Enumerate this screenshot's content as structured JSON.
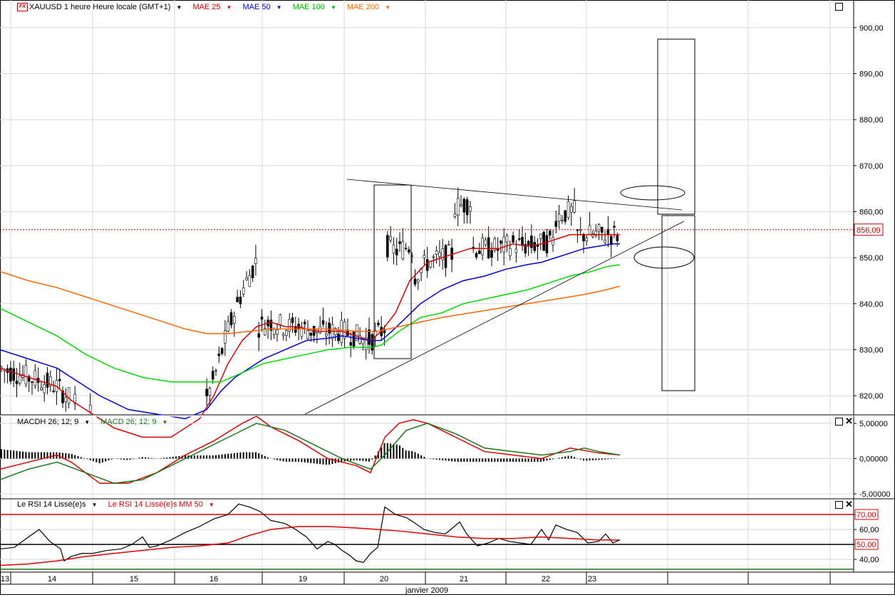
{
  "header": {
    "symbol": "XAUUSD 1 heure Heure locale (GMT+1)",
    "mae25": "MAE 25",
    "mae50": "MAE 50",
    "mae100": "MAE 100",
    "mae200": "MAE 200"
  },
  "macd_header": {
    "hist": "MACDH 26; 12; 9",
    "line": "MACD  26; 12; 9"
  },
  "rsi_header": {
    "rsi": "Le RSI 14 Lissé(e)s",
    "rsi_ma": "Le RSI 14 Lissé(e)s MM 50"
  },
  "colors": {
    "mae25": "#e00000",
    "mae50": "#0000e0",
    "mae100": "#00dd00",
    "mae200": "#ff6600",
    "macd_signal": "#1a7a1a",
    "grid": "#d8d8d8",
    "last_price": "#cc0000"
  },
  "x_axis": {
    "days": [
      "13",
      "14",
      "15",
      "16",
      "19",
      "20",
      "21",
      "22",
      "23"
    ],
    "month": "janvier 2009"
  },
  "chart_data": [
    {
      "type": "line",
      "title": "XAUUSD 1 heure",
      "price_axis": {
        "ticks": [
          "900,00",
          "890,00",
          "880,00",
          "870,00",
          "860,00",
          "850,00",
          "840,00",
          "830,00",
          "820,00"
        ],
        "ylim": [
          816,
          906
        ]
      },
      "last_price": "856,09",
      "series": [
        {
          "name": "MAE 25",
          "color": "#e00000",
          "points": [
            [
              0,
              826
            ],
            [
              40,
              824
            ],
            [
              80,
              822
            ],
            [
              100,
              819
            ],
            [
              130,
              816
            ],
            [
              160,
              813
            ],
            [
              200,
              811
            ],
            [
              240,
              811
            ],
            [
              280,
              815
            ],
            [
              300,
              820
            ],
            [
              320,
              827
            ],
            [
              340,
              832
            ],
            [
              360,
              835
            ],
            [
              380,
              836
            ],
            [
              400,
              835
            ],
            [
              420,
              835
            ],
            [
              440,
              834
            ],
            [
              460,
              834
            ],
            [
              480,
              834
            ],
            [
              500,
              833
            ],
            [
              520,
              832
            ],
            [
              535,
              834
            ],
            [
              555,
              838
            ],
            [
              575,
              845
            ],
            [
              600,
              849
            ],
            [
              620,
              850
            ],
            [
              640,
              851
            ],
            [
              660,
              852
            ],
            [
              680,
              852
            ],
            [
              700,
              852
            ],
            [
              720,
              853
            ],
            [
              740,
              852.5
            ],
            [
              760,
              853
            ],
            [
              780,
              854
            ],
            [
              800,
              855
            ],
            [
              820,
              855
            ],
            [
              840,
              855
            ],
            [
              860,
              855
            ],
            [
              870,
              855
            ]
          ]
        },
        {
          "name": "MAE 50",
          "color": "#0000e0",
          "points": [
            [
              0,
              830
            ],
            [
              40,
              828
            ],
            [
              80,
              826
            ],
            [
              110,
              823
            ],
            [
              140,
              820
            ],
            [
              180,
              817
            ],
            [
              220,
              816
            ],
            [
              260,
              815
            ],
            [
              290,
              817
            ],
            [
              310,
              821
            ],
            [
              330,
              824
            ],
            [
              350,
              826
            ],
            [
              370,
              828
            ],
            [
              400,
              830
            ],
            [
              430,
              832
            ],
            [
              460,
              832.5
            ],
            [
              480,
              833
            ],
            [
              500,
              832.5
            ],
            [
              520,
              832
            ],
            [
              535,
              832
            ],
            [
              550,
              834
            ],
            [
              570,
              837
            ],
            [
              590,
              840
            ],
            [
              620,
              843
            ],
            [
              650,
              845
            ],
            [
              680,
              846
            ],
            [
              710,
              847.5
            ],
            [
              740,
              848.5
            ],
            [
              760,
              849
            ],
            [
              780,
              850
            ],
            [
              800,
              851
            ],
            [
              820,
              852
            ],
            [
              840,
              852.5
            ],
            [
              860,
              853
            ],
            [
              870,
              853
            ]
          ]
        },
        {
          "name": "MAE 100",
          "color": "#00dd00",
          "points": [
            [
              0,
              839
            ],
            [
              40,
              836
            ],
            [
              80,
              833
            ],
            [
              120,
              829
            ],
            [
              160,
              826
            ],
            [
              200,
              824
            ],
            [
              240,
              823
            ],
            [
              280,
              823
            ],
            [
              310,
              823
            ],
            [
              340,
              825
            ],
            [
              370,
              827
            ],
            [
              400,
              828
            ],
            [
              430,
              829
            ],
            [
              460,
              830
            ],
            [
              490,
              830.5
            ],
            [
              520,
              830.5
            ],
            [
              535,
              831
            ],
            [
              560,
              834
            ],
            [
              590,
              837
            ],
            [
              620,
              838
            ],
            [
              650,
              840
            ],
            [
              680,
              841
            ],
            [
              710,
              842
            ],
            [
              740,
              843
            ],
            [
              770,
              844.5
            ],
            [
              800,
              846
            ],
            [
              830,
              847
            ],
            [
              850,
              848
            ],
            [
              870,
              848.5
            ]
          ]
        },
        {
          "name": "MAE 200",
          "color": "#ff6600",
          "points": [
            [
              0,
              847
            ],
            [
              40,
              845
            ],
            [
              80,
              843.5
            ],
            [
              120,
              841.5
            ],
            [
              160,
              839.5
            ],
            [
              200,
              837.5
            ],
            [
              230,
              836
            ],
            [
              260,
              834.5
            ],
            [
              290,
              833.5
            ],
            [
              320,
              833.5
            ],
            [
              350,
              834
            ],
            [
              380,
              834.5
            ],
            [
              420,
              834.5
            ],
            [
              460,
              834.5
            ],
            [
              500,
              834
            ],
            [
              530,
              834
            ],
            [
              560,
              835
            ],
            [
              590,
              836
            ],
            [
              620,
              837
            ],
            [
              660,
              838
            ],
            [
              700,
              839
            ],
            [
              740,
              840
            ],
            [
              780,
              841
            ],
            [
              820,
              842
            ],
            [
              850,
              843
            ],
            [
              870,
              843.8
            ]
          ]
        }
      ]
    },
    {
      "type": "line",
      "title": "MACD 26; 12; 9",
      "y_axis": {
        "ticks": [
          "5,00000",
          "0,00000",
          "-5,00000"
        ],
        "ylim": [
          -5.6,
          6
        ]
      },
      "series": [
        {
          "name": "MACDH 26; 12; 9",
          "color": "#000000",
          "type": "bar"
        },
        {
          "name": "MACD  26; 12; 9",
          "color": "#1a7a1a"
        }
      ]
    },
    {
      "type": "line",
      "title": "Le RSI 14 Lissé(e)s",
      "y_axis": {
        "ticks": [
          "70,00",
          "60,00",
          "50,00",
          "40,00"
        ],
        "ylim": [
          32,
          80
        ],
        "levels": [
          70,
          50,
          30
        ]
      },
      "series": [
        {
          "name": "Le RSI 14 Lissé(e)s",
          "color": "#000000",
          "points": [
            [
              0,
              47
            ],
            [
              20,
              48
            ],
            [
              40,
              55
            ],
            [
              55,
              60
            ],
            [
              70,
              52
            ],
            [
              85,
              47
            ],
            [
              90,
              39
            ],
            [
              100,
              42
            ],
            [
              115,
              44
            ],
            [
              130,
              44
            ],
            [
              150,
              46
            ],
            [
              170,
              47
            ],
            [
              185,
              50
            ],
            [
              200,
              55
            ],
            [
              210,
              48
            ],
            [
              220,
              49
            ],
            [
              240,
              53
            ],
            [
              260,
              58
            ],
            [
              280,
              62
            ],
            [
              300,
              67
            ],
            [
              320,
              70
            ],
            [
              335,
              77
            ],
            [
              350,
              75
            ],
            [
              365,
              72
            ],
            [
              380,
              66
            ],
            [
              400,
              64
            ],
            [
              415,
              60
            ],
            [
              430,
              55
            ],
            [
              445,
              47
            ],
            [
              460,
              52
            ],
            [
              470,
              50
            ],
            [
              480,
              46
            ],
            [
              490,
              43
            ],
            [
              500,
              39
            ],
            [
              510,
              38
            ],
            [
              520,
              44
            ],
            [
              530,
              48
            ],
            [
              540,
              75
            ],
            [
              555,
              70
            ],
            [
              570,
              68
            ],
            [
              580,
              65
            ],
            [
              595,
              60
            ],
            [
              610,
              58
            ],
            [
              625,
              57
            ],
            [
              635,
              61
            ],
            [
              645,
              65
            ],
            [
              655,
              57
            ],
            [
              670,
              49
            ],
            [
              685,
              51
            ],
            [
              700,
              54
            ],
            [
              715,
              52
            ],
            [
              730,
              51
            ],
            [
              745,
              50
            ],
            [
              760,
              60
            ],
            [
              770,
              53
            ],
            [
              780,
              63
            ],
            [
              795,
              60
            ],
            [
              810,
              58
            ],
            [
              825,
              51
            ],
            [
              840,
              52
            ],
            [
              850,
              57
            ],
            [
              860,
              51
            ],
            [
              870,
              53
            ]
          ]
        },
        {
          "name": "Le RSI 14 Lissé(e)s MM 50",
          "color": "#e00000",
          "points": [
            [
              0,
              36
            ],
            [
              40,
              37
            ],
            [
              80,
              39
            ],
            [
              120,
              42
            ],
            [
              160,
              44
            ],
            [
              200,
              46
            ],
            [
              240,
              48
            ],
            [
              280,
              49
            ],
            [
              320,
              51
            ],
            [
              350,
              56
            ],
            [
              380,
              60
            ],
            [
              420,
              62
            ],
            [
              460,
              62
            ],
            [
              500,
              61
            ],
            [
              530,
              60
            ],
            [
              560,
              59
            ],
            [
              600,
              57
            ],
            [
              640,
              55
            ],
            [
              680,
              54
            ],
            [
              720,
              54
            ],
            [
              760,
              55
            ],
            [
              800,
              54
            ],
            [
              840,
              53
            ],
            [
              870,
              53
            ]
          ]
        }
      ]
    }
  ]
}
